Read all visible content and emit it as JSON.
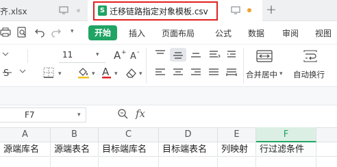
{
  "tabs": {
    "inactive_title": "齐.xlsx",
    "active_title": "迁移链路指定对象模板.csv",
    "csv_icon_glyph": "S",
    "add_tab_label": "+"
  },
  "menu": {
    "items": [
      "开始",
      "插入",
      "页面布局",
      "公式",
      "数据",
      "审阅",
      "视图"
    ],
    "active_index": 0
  },
  "toolbar": {
    "font_size": "11",
    "merge_label": "合并居中",
    "wrap_label": "自动换行",
    "chevron": "▾"
  },
  "formula_bar": {
    "cell_ref": "F7",
    "fx_label": "fx"
  },
  "sheet": {
    "columns": [
      "A",
      "B",
      "C",
      "D",
      "E",
      "F"
    ],
    "selected_column": "F",
    "header_row": [
      "源端库名",
      "源端表名",
      "目标端库名",
      "目标端表名",
      "列映射",
      "行过滤条件"
    ]
  },
  "colors": {
    "accent": "#1fa463",
    "highlight_border": "#e02020",
    "unsaved_dot": "#f0a030",
    "font_color_underline": "#e02020"
  }
}
